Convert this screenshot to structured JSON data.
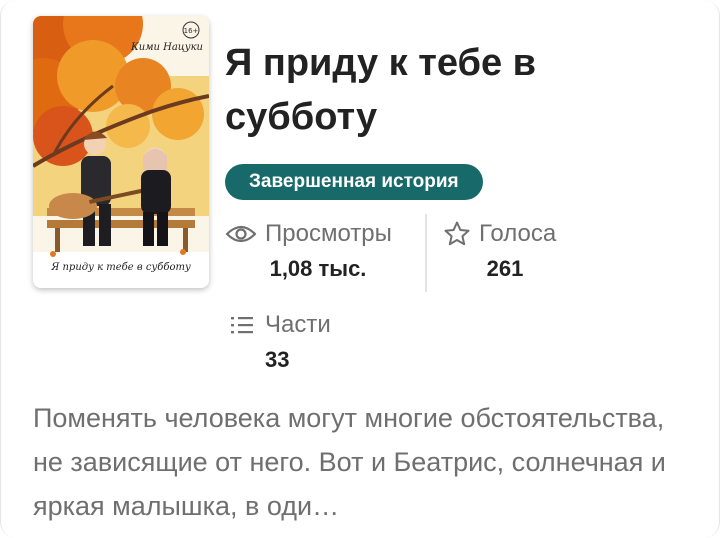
{
  "story": {
    "title": "Я приду к тебе в субботу",
    "status_badge": "Завершенная история",
    "cover": {
      "author_caption": "Кими Нацуки",
      "title_caption": "Я приду к тебе в субботу",
      "age_rating": "16+"
    },
    "stats": {
      "views": {
        "label": "Просмотры",
        "value": "1,08 тыс.",
        "icon": "eye-icon"
      },
      "votes": {
        "label": "Голоса",
        "value": "261",
        "icon": "star-icon"
      },
      "parts": {
        "label": "Части",
        "value": "33",
        "icon": "list-icon"
      }
    },
    "description": "Поменять человека могут многие обстоятельства, не зависящие от него. Вот и Беатрис, солнечная и яркая малышка, в оди…"
  },
  "colors": {
    "badge_background": "#186a6a",
    "title_text": "#222222",
    "secondary_text": "#6f6f6f"
  }
}
